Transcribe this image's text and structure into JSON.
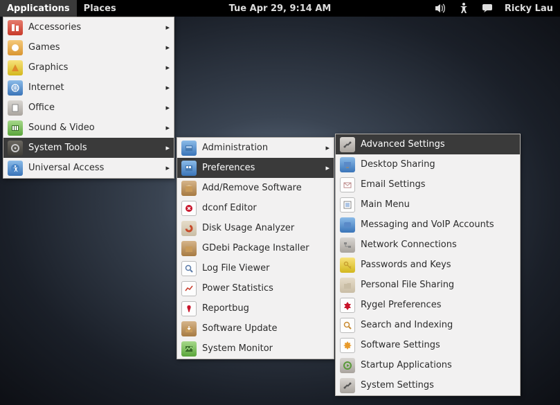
{
  "panel": {
    "applications_label": "Applications",
    "places_label": "Places",
    "datetime": "Tue Apr 29,  9:14 AM",
    "user": "Ricky Lau"
  },
  "menu1": {
    "items": [
      {
        "label": "Accessories",
        "arrow": true
      },
      {
        "label": "Games",
        "arrow": true
      },
      {
        "label": "Graphics",
        "arrow": true
      },
      {
        "label": "Internet",
        "arrow": true
      },
      {
        "label": "Office",
        "arrow": true
      },
      {
        "label": "Sound & Video",
        "arrow": true
      },
      {
        "label": "System Tools",
        "arrow": true,
        "highlight": true
      },
      {
        "label": "Universal Access",
        "arrow": true
      }
    ]
  },
  "menu2": {
    "items": [
      {
        "label": "Administration",
        "arrow": true
      },
      {
        "label": "Preferences",
        "arrow": true,
        "highlight": true
      },
      {
        "label": "Add/Remove Software"
      },
      {
        "label": "dconf Editor"
      },
      {
        "label": "Disk Usage Analyzer"
      },
      {
        "label": "GDebi Package Installer"
      },
      {
        "label": "Log File Viewer"
      },
      {
        "label": "Power Statistics"
      },
      {
        "label": "Reportbug"
      },
      {
        "label": "Software Update"
      },
      {
        "label": "System Monitor"
      }
    ]
  },
  "menu3": {
    "items": [
      {
        "label": "Advanced Settings",
        "highlight": true
      },
      {
        "label": "Desktop Sharing"
      },
      {
        "label": "Email Settings"
      },
      {
        "label": "Main Menu"
      },
      {
        "label": "Messaging and VoIP Accounts"
      },
      {
        "label": "Network Connections"
      },
      {
        "label": "Passwords and Keys"
      },
      {
        "label": "Personal File Sharing"
      },
      {
        "label": "Rygel Preferences"
      },
      {
        "label": "Search and Indexing"
      },
      {
        "label": "Software Settings"
      },
      {
        "label": "Startup Applications"
      },
      {
        "label": "System Settings"
      }
    ]
  }
}
